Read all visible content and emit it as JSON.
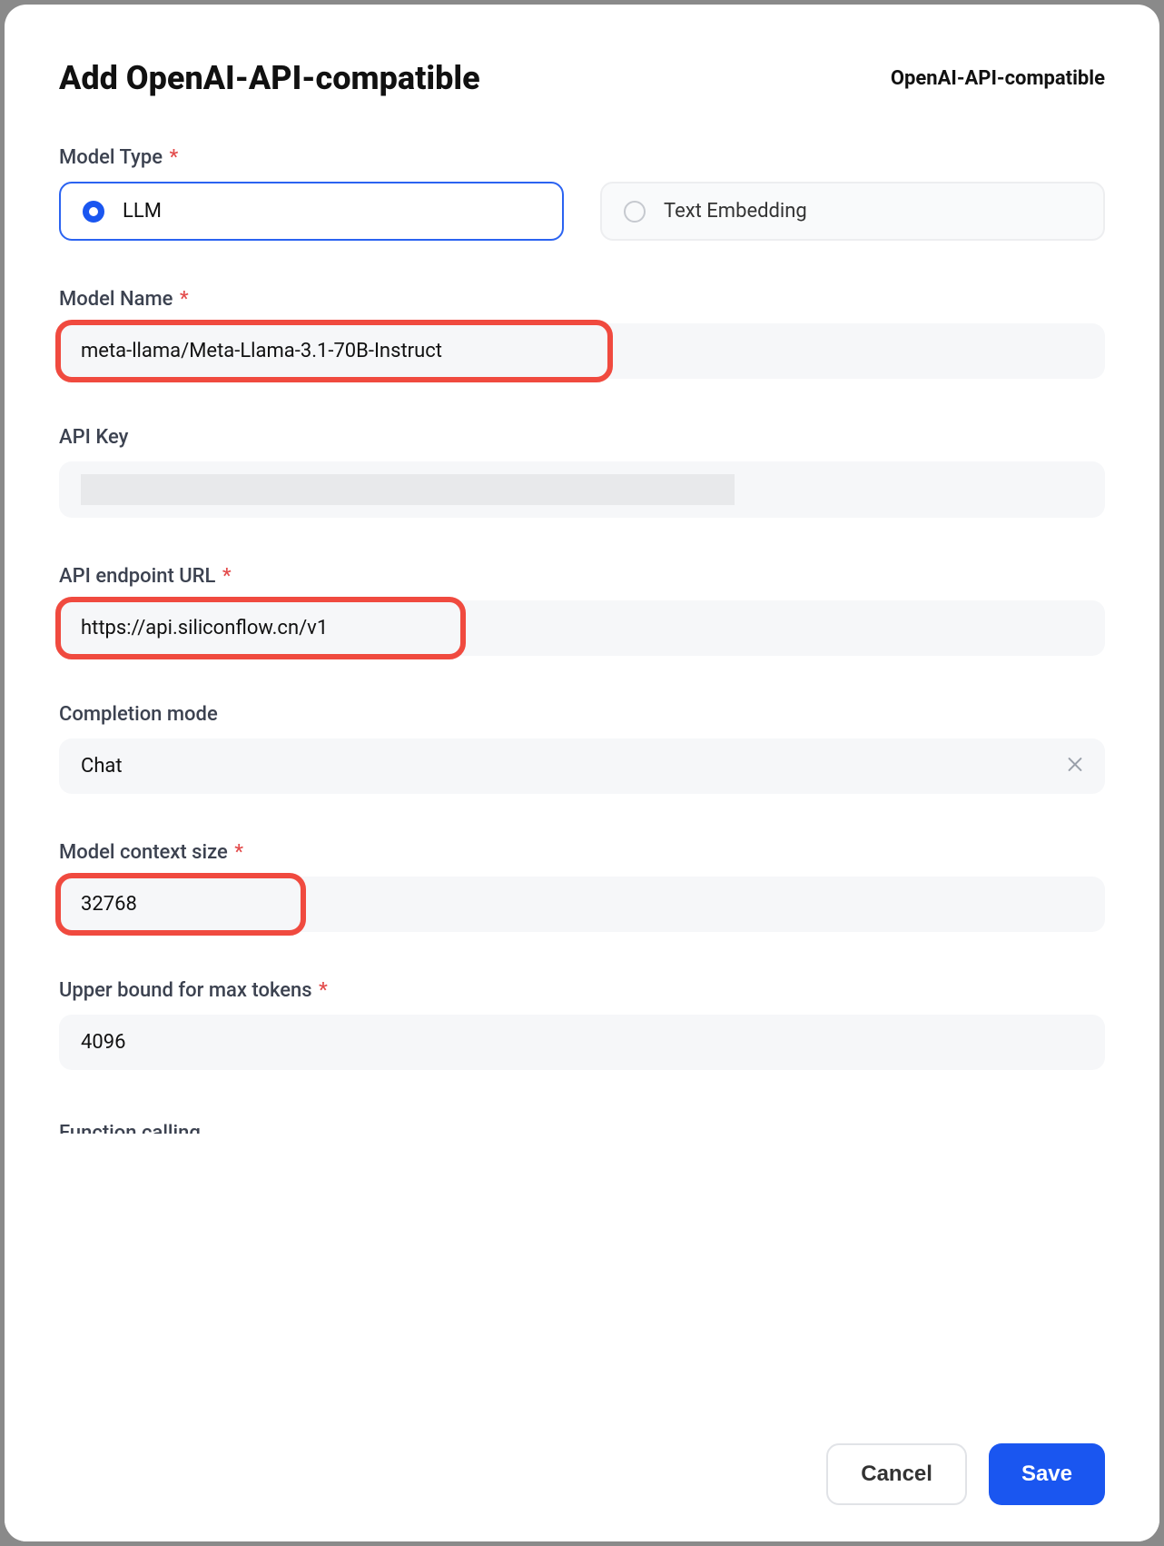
{
  "header": {
    "title": "Add OpenAI-API-compatible",
    "subtitle": "OpenAI-API-compatible"
  },
  "fields": {
    "modelType": {
      "label": "Model Type",
      "opt1": "LLM",
      "opt2": "Text Embedding"
    },
    "modelName": {
      "label": "Model Name",
      "value": "meta-llama/Meta-Llama-3.1-70B-Instruct"
    },
    "apiKey": {
      "label": "API Key",
      "value": ""
    },
    "apiUrl": {
      "label": "API endpoint URL",
      "value": "https://api.siliconflow.cn/v1"
    },
    "completion": {
      "label": "Completion mode",
      "value": "Chat"
    },
    "ctx": {
      "label": "Model context size",
      "value": "32768"
    },
    "maxTokens": {
      "label": "Upper bound for max tokens",
      "value": "4096"
    },
    "funcCalling": {
      "labelVisible": "Function calling"
    }
  },
  "footer": {
    "cancel": "Cancel",
    "save": "Save"
  }
}
